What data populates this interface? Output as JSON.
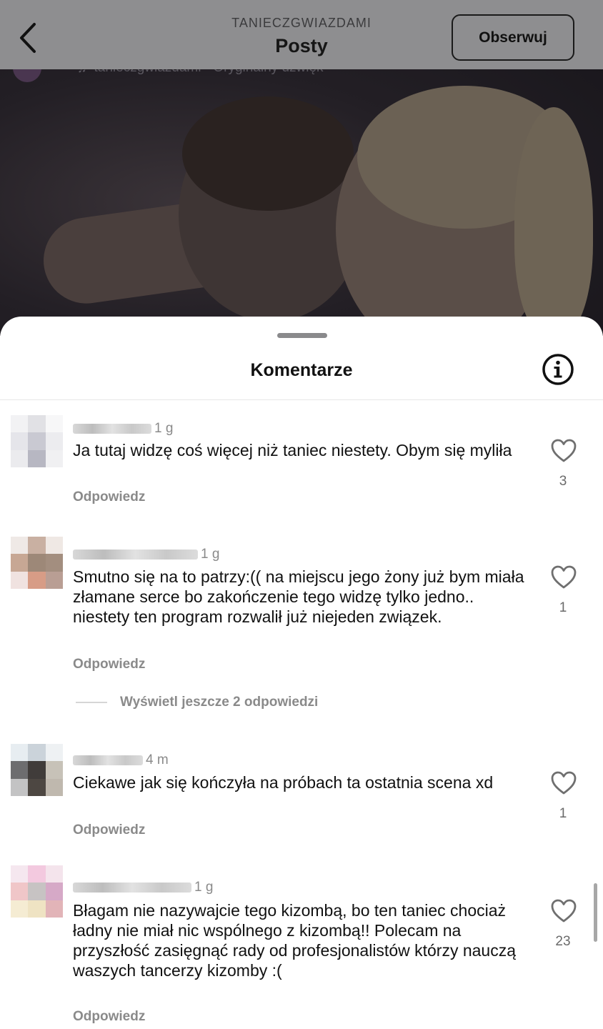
{
  "header": {
    "account": "TANIECZGWIAZDAMI",
    "title": "Posty",
    "follow_label": "Obserwuj"
  },
  "video": {
    "sound_label": "tanieczgwiazdami · Oryginalny dźwięk"
  },
  "sheet": {
    "title": "Komentarze"
  },
  "comments": [
    {
      "time": "1 g",
      "text": "Ja tutaj widzę coś więcej niż taniec niestety. Obym się myliła",
      "reply_label": "Odpowiedz",
      "likes": "3"
    },
    {
      "time": "1 g",
      "text": "Smutno się na to patrzy:(( na miejscu jego żony już bym miała złamane serce bo zakończenie tego widzę tylko jedno.. niestety ten program rozwalił już niejeden związek.",
      "reply_label": "Odpowiedz",
      "likes": "1"
    },
    {
      "time": "4 m",
      "text": "Ciekawe jak się kończyła na próbach ta ostatnia scena xd",
      "reply_label": "Odpowiedz",
      "likes": "1"
    },
    {
      "time": "1 g",
      "text": "Błagam nie nazywajcie tego kizombą, bo ten taniec chociaż ładny nie miał nic wspólnego z kizombą!! Polecam na przyszłość zasięgnąć rady od profesjonalistów którzy nauczą waszych tancerzy kizomby :(",
      "reply_label": "Odpowiedz",
      "likes": "23"
    }
  ],
  "view_more_replies": "Wyświetl jeszcze 2 odpowiedzi",
  "colors": {
    "header_overlay": "#8e8e90",
    "secondary_text": "#8a8a8a",
    "primary_text": "#111111"
  }
}
